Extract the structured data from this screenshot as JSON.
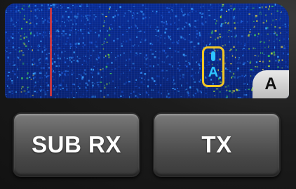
{
  "panadapter": {
    "vfo_cursor_label": "A",
    "vfo_tag_label": "A"
  },
  "buttons": {
    "sub_rx_label": "SUB RX",
    "tx_label": "TX"
  },
  "colors": {
    "waterfall_background": "#0b2a8c",
    "marker_line": "#e03a3a",
    "vfo_cursor_border": "#f2c624",
    "vfo_cursor_text": "#2ec4ff"
  }
}
